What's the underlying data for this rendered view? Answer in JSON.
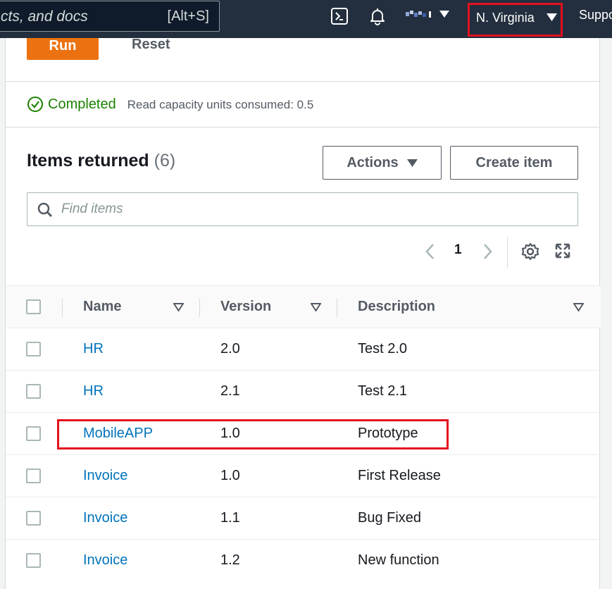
{
  "topbar": {
    "search_text": "cts, and docs",
    "search_shortcut": "[Alt+S]",
    "region": "N. Virginia",
    "support": "Suppo",
    "colors": {
      "background": "#232f3e",
      "highlight": "#e3111e"
    }
  },
  "query": {
    "run_label": "Run",
    "reset_label": "Reset",
    "status_text": "Completed",
    "status_detail": "Read capacity units consumed: 0.5"
  },
  "items": {
    "title": "Items returned",
    "count": "(6)",
    "actions_label": "Actions",
    "create_label": "Create item",
    "find_placeholder": "Find items",
    "page": "1",
    "columns": [
      "Name",
      "Version",
      "Description"
    ],
    "rows": [
      {
        "name": "HR",
        "version": "2.0",
        "description": "Test 2.0"
      },
      {
        "name": "HR",
        "version": "2.1",
        "description": "Test 2.1"
      },
      {
        "name": "MobileAPP",
        "version": "1.0",
        "description": "Prototype"
      },
      {
        "name": "Invoice",
        "version": "1.0",
        "description": "First Release"
      },
      {
        "name": "Invoice",
        "version": "1.1",
        "description": "Bug Fixed"
      },
      {
        "name": "Invoice",
        "version": "1.2",
        "description": "New function"
      }
    ]
  }
}
